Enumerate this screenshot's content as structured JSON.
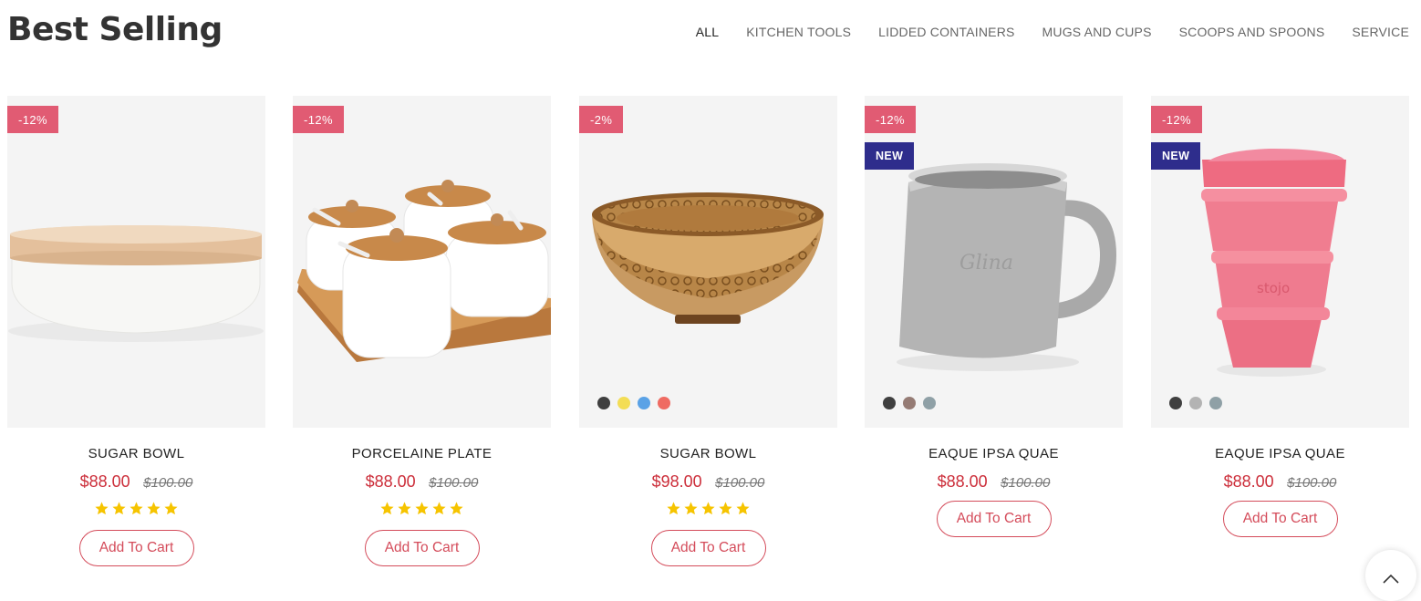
{
  "section": {
    "title": "Best Selling"
  },
  "tabs": [
    {
      "label": "ALL",
      "active": true
    },
    {
      "label": "KITCHEN TOOLS"
    },
    {
      "label": "LIDDED CONTAINERS"
    },
    {
      "label": "MUGS AND CUPS"
    },
    {
      "label": "SCOOPS AND SPOONS"
    },
    {
      "label": "SERVICE"
    }
  ],
  "products": [
    {
      "name": "SUGAR BOWL",
      "price": "$88.00",
      "old_price": "$100.00",
      "discount": "-12%",
      "rating": 5,
      "button": "Add To Cart",
      "image": "white-bowl-wood-lid"
    },
    {
      "name": "PORCELAINE PLATE",
      "price": "$88.00",
      "old_price": "$100.00",
      "discount": "-12%",
      "rating": 5,
      "button": "Add To Cart",
      "image": "jar-set-on-tray"
    },
    {
      "name": "SUGAR BOWL",
      "price": "$98.00",
      "old_price": "$100.00",
      "discount": "-2%",
      "rating": 5,
      "button": "Add To Cart",
      "image": "patterned-wooden-bowl",
      "swatches": [
        "#3f3f3f",
        "#f3dd55",
        "#5aa2e6",
        "#ef6b62"
      ]
    },
    {
      "name": "EAQUE IPSA QUAE",
      "price": "$88.00",
      "old_price": "$100.00",
      "discount": "-12%",
      "new_label": "NEW",
      "button": "Add To Cart",
      "image": "grey-mug",
      "swatches": [
        "#3f3f3f",
        "#957b74",
        "#8fa0a6"
      ]
    },
    {
      "name": "EAQUE IPSA QUAE",
      "price": "$88.00",
      "old_price": "$100.00",
      "discount": "-12%",
      "new_label": "NEW",
      "button": "Add To Cart",
      "image": "pink-collapsible-cup",
      "swatches": [
        "#3f3f3f",
        "#b3b3b3",
        "#8fa0a6"
      ]
    }
  ],
  "colors": {
    "sale_badge": "#e15b73",
    "new_badge": "#2e2d8c",
    "price": "#cc2e3a",
    "button_border": "#d44b5a",
    "star": "#f6c400"
  },
  "scroll_top": {
    "icon": "chevron-up-icon"
  }
}
